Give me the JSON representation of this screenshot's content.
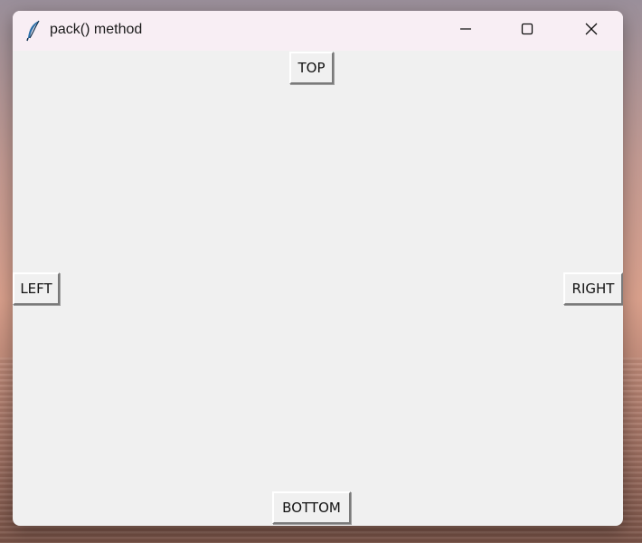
{
  "window": {
    "title": "pack() method",
    "app_icon": "feather-icon"
  },
  "controls": {
    "minimize": "minimize-icon",
    "maximize": "maximize-icon",
    "close": "close-icon"
  },
  "buttons": {
    "top": "TOP",
    "left": "LEFT",
    "right": "RIGHT",
    "bottom": "BOTTOM"
  }
}
